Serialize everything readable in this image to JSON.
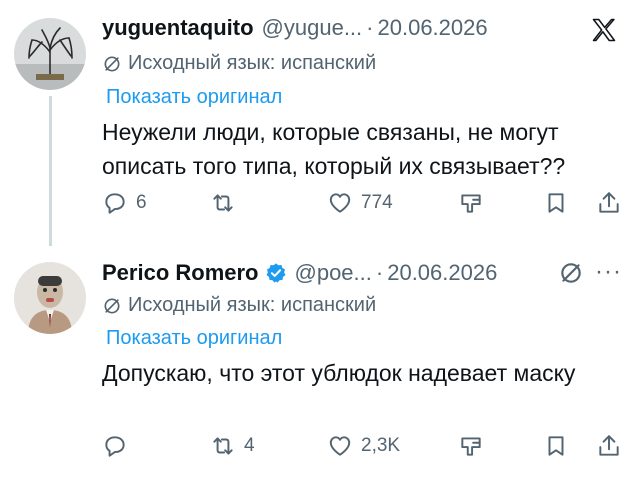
{
  "tweets": [
    {
      "display_name": "yuguentaquito",
      "handle": "@yugue...",
      "separator": "·",
      "date": "20.06.2026",
      "translated_from": "Исходный язык: испанский",
      "show_original": "Показать оригинал",
      "text": "Неужели люди, которые связаны, не могут описать того типа, который их связывает??",
      "replies": "6",
      "retweets": "",
      "likes": "774",
      "verified": false,
      "header_icon": "x-logo-icon"
    },
    {
      "display_name": "Perico Romero",
      "handle": "@poe...",
      "separator": "·",
      "date": "20.06.2026",
      "translated_from": "Исходный язык: испанский",
      "show_original": "Показать оригинал",
      "text": "Допускаю, что этот ублюдок надевает маску",
      "replies": "",
      "retweets": "4",
      "likes": "2,3K",
      "verified": true,
      "header_icon": "grok-slash-icon",
      "more_label": "···"
    }
  ],
  "colors": {
    "text": "#0f1419",
    "secondary": "#536471",
    "link": "#1d9bf0",
    "verified": "#1d9bf0",
    "thread_line": "#cfd9de"
  }
}
